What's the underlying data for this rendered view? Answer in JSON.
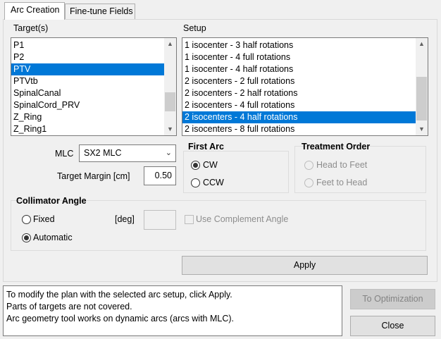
{
  "tabs": [
    {
      "label": "Arc Creation",
      "active": true
    },
    {
      "label": "Fine-tune Fields",
      "active": false
    }
  ],
  "targets": {
    "label": "Target(s)",
    "items": [
      "P1",
      "P2",
      "PTV",
      "PTVtb",
      "SpinalCanal",
      "SpinalCord_PRV",
      "Z_Ring",
      "Z_Ring1"
    ],
    "selected": "PTV"
  },
  "setup": {
    "label": "Setup",
    "items": [
      "1 isocenter - 3 half rotations",
      "1 isocenter - 4 full rotations",
      "1 isocenter - 4 half rotations",
      "2 isocenters - 2 full rotations",
      "2 isocenters - 2 half rotations",
      "2 isocenters - 4 full rotations",
      "2 isocenters - 4 half rotations",
      "2 isocenters - 8 full rotations"
    ],
    "selected": "2 isocenters - 4 half rotations"
  },
  "mlc": {
    "label": "MLC",
    "value": "SX2 MLC"
  },
  "target_margin": {
    "label": "Target Margin [cm]",
    "value": "0.50"
  },
  "first_arc": {
    "title": "First Arc",
    "options": [
      "CW",
      "CCW"
    ],
    "selected": "CW"
  },
  "treatment_order": {
    "title": "Treatment Order",
    "options": [
      "Head to Feet",
      "Feet to Head"
    ],
    "enabled": false
  },
  "collimator": {
    "title": "Collimator Angle",
    "options": [
      "Fixed",
      "Automatic"
    ],
    "selected": "Automatic",
    "deg_label": "[deg]",
    "deg_value": "",
    "complement_label": "Use Complement Angle"
  },
  "apply_label": "Apply",
  "messages": [
    "To modify the plan with the selected arc setup, click Apply.",
    "Parts of targets are not covered.",
    "Arc geometry tool works on dynamic arcs (arcs with MLC)."
  ],
  "to_optimization_label": "To Optimization",
  "close_label": "Close",
  "icons": {
    "scroll_up": "chevron-up-icon",
    "scroll_down": "chevron-down-icon",
    "combo": "chevron-down-icon"
  }
}
